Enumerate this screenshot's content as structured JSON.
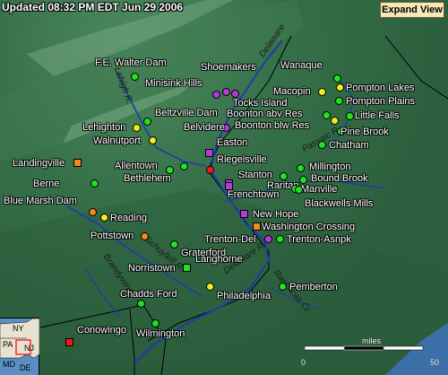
{
  "header": {
    "title": "Updated 08:32 PM EDT Jun 29 2006",
    "expand_label": "Expand View"
  },
  "colors": {
    "green": "#22e022",
    "yellow": "#f2ec1e",
    "orange": "#f08a18",
    "purple": "#b53ad8",
    "red": "#ee1c1c",
    "lavender": "#c46be0"
  },
  "rivers": {
    "delaware": "Delaware",
    "lehigh": "Lehigh R.",
    "schuylkill": "Schuylkill R.",
    "brandywine": "Brandywine",
    "delaware_r": "Delaware R.",
    "rancocas": "Rancocas Cr.",
    "passaic": "Passaic R."
  },
  "inset": {
    "ny": "NY",
    "pa": "PA",
    "nj": "NJ",
    "md": "MD",
    "de": "DE"
  },
  "scale": {
    "title": "miles",
    "zero": "0",
    "fifty": "50"
  },
  "stations": [
    {
      "name": "F.E. Walter Dam",
      "color": "green",
      "shape": "circle"
    },
    {
      "name": "Shoemakers",
      "color": "purple",
      "shape": "circle"
    },
    {
      "name": "Minisink Hills",
      "color": "purple",
      "shape": "circle"
    },
    {
      "name": "Wanaque",
      "color": "green",
      "shape": "circle"
    },
    {
      "name": "Pompton Lakes",
      "color": "yellow",
      "shape": "circle"
    },
    {
      "name": "Macopin",
      "color": "yellow",
      "shape": "circle"
    },
    {
      "name": "Pompton Plains",
      "color": "green",
      "shape": "circle"
    },
    {
      "name": "Tocks Island",
      "color": "purple",
      "shape": "circle"
    },
    {
      "name": "Boonton abv Res",
      "color": "green",
      "shape": "circle"
    },
    {
      "name": "Little Falls",
      "color": "green",
      "shape": "circle"
    },
    {
      "name": "Beltzville Dam",
      "color": "green",
      "shape": "circle"
    },
    {
      "name": "Boonton blw Res",
      "color": "yellow",
      "shape": "circle"
    },
    {
      "name": "Lehighton",
      "color": "yellow",
      "shape": "circle"
    },
    {
      "name": "Belvidere",
      "color": "purple",
      "shape": "circle"
    },
    {
      "name": "Pine Brook",
      "color": "green",
      "shape": "circle"
    },
    {
      "name": "Walnutport",
      "color": "yellow",
      "shape": "circle"
    },
    {
      "name": "Easton",
      "color": "purple",
      "shape": "square"
    },
    {
      "name": "Chatham",
      "color": "green",
      "shape": "circle"
    },
    {
      "name": "Landingville",
      "color": "orange",
      "shape": "square"
    },
    {
      "name": "Riegelsville",
      "color": "red",
      "shape": "circle"
    },
    {
      "name": "Allentown",
      "color": "green",
      "shape": "circle"
    },
    {
      "name": "Millington",
      "color": "green",
      "shape": "circle"
    },
    {
      "name": "Bethlehem",
      "color": "green",
      "shape": "circle"
    },
    {
      "name": "Stanton",
      "color": "purple",
      "shape": "square"
    },
    {
      "name": "Bound Brook",
      "color": "green",
      "shape": "circle"
    },
    {
      "name": "Raritan",
      "color": "green",
      "shape": "circle"
    },
    {
      "name": "Berne",
      "color": "green",
      "shape": "circle"
    },
    {
      "name": "Manville",
      "color": "green",
      "shape": "circle"
    },
    {
      "name": "Frenchtown",
      "color": "purple",
      "shape": "square"
    },
    {
      "name": "Blackwells Mills",
      "color": "green",
      "shape": "circle"
    },
    {
      "name": "Blue Marsh Dam",
      "color": "orange",
      "shape": "circle"
    },
    {
      "name": "New Hope",
      "color": "purple",
      "shape": "square"
    },
    {
      "name": "Reading",
      "color": "yellow",
      "shape": "circle"
    },
    {
      "name": "Washington Crossing",
      "color": "orange",
      "shape": "square"
    },
    {
      "name": "Pottstown",
      "color": "orange",
      "shape": "circle"
    },
    {
      "name": "Graterford",
      "color": "green",
      "shape": "circle"
    },
    {
      "name": "Trenton-Del",
      "color": "purple",
      "shape": "circle"
    },
    {
      "name": "Trenton-Asnpk",
      "color": "green",
      "shape": "circle"
    },
    {
      "name": "Langhorne",
      "color": "green",
      "shape": "square"
    },
    {
      "name": "Norristown",
      "color": "green",
      "shape": "square"
    },
    {
      "name": "Pemberton",
      "color": "green",
      "shape": "circle"
    },
    {
      "name": "Chadds Ford",
      "color": "green",
      "shape": "circle"
    },
    {
      "name": "Philadelphia",
      "color": "yellow",
      "shape": "circle"
    },
    {
      "name": "Conowingo",
      "color": "red",
      "shape": "square"
    },
    {
      "name": "Wilmington",
      "color": "green",
      "shape": "circle"
    }
  ]
}
